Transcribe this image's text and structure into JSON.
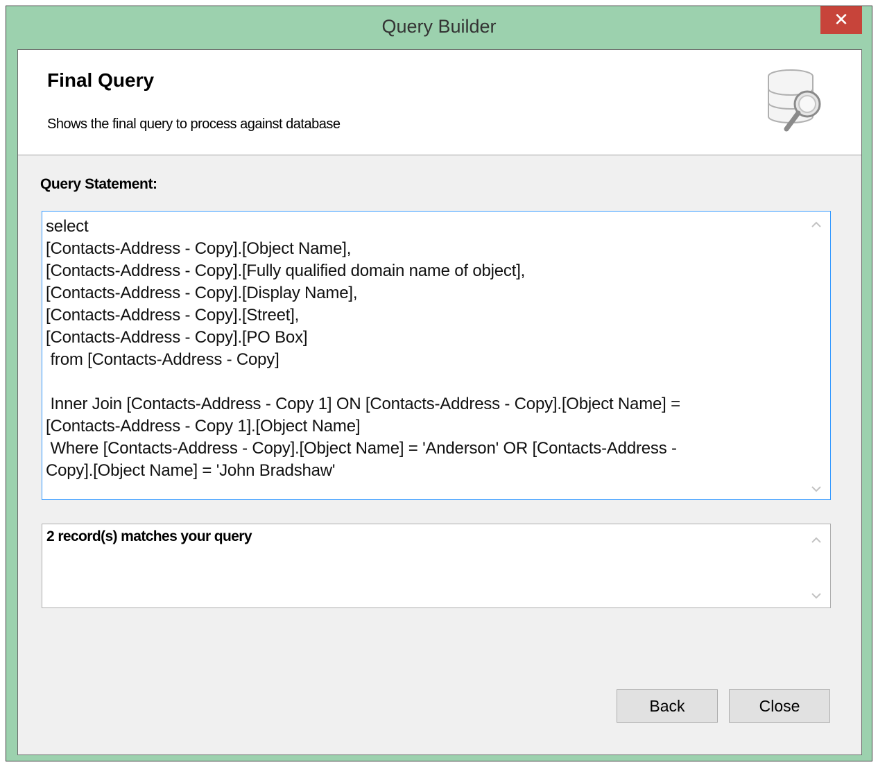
{
  "window": {
    "title": "Query Builder",
    "close_glyph": "✕"
  },
  "header": {
    "title": "Final Query",
    "subtitle": "Shows the final query to process against database",
    "icon": "database-search-icon"
  },
  "query": {
    "label": "Query Statement:",
    "text": "select\n[Contacts-Address - Copy].[Object Name],\n[Contacts-Address - Copy].[Fully qualified domain name of object],\n[Contacts-Address - Copy].[Display Name],\n[Contacts-Address - Copy].[Street],\n[Contacts-Address - Copy].[PO Box]\n from [Contacts-Address - Copy]\n\n Inner Join [Contacts-Address - Copy 1] ON [Contacts-Address - Copy].[Object Name] =\n[Contacts-Address - Copy 1].[Object Name]\n Where [Contacts-Address - Copy].[Object Name] = 'Anderson' OR [Contacts-Address -\nCopy].[Object Name] = 'John Bradshaw'"
  },
  "result": {
    "text": "2 record(s) matches your query"
  },
  "buttons": {
    "back": "Back",
    "close": "Close"
  },
  "colors": {
    "frame": "#9cd1ae",
    "close_button": "#c7443a",
    "focus_border": "#3399ff"
  }
}
